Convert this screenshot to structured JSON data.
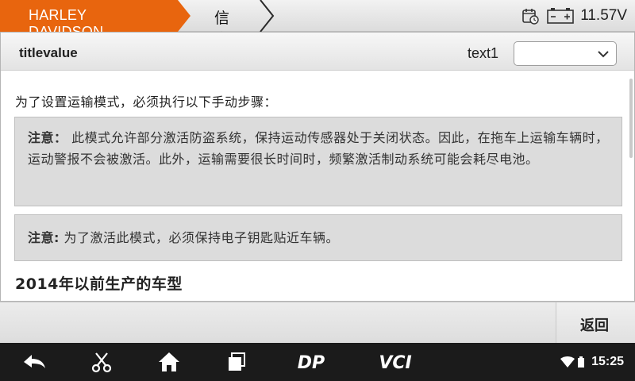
{
  "topbar": {
    "brand": "HARLEY DAVIDSON",
    "current": "信息",
    "voltage": "11.57V",
    "icons": [
      "calendar-clock-icon",
      "battery-icon"
    ],
    "accent_color": "#e8650e"
  },
  "panel": {
    "title": "titlevalue",
    "select_label": "text1",
    "select_value": ""
  },
  "content": {
    "intro": "为了设置运输模式，必须执行以下手动步骤：",
    "note1": {
      "label": "注意：",
      "text": " 此模式允许部分激活防盗系统，保持运动传感器处于关闭状态。因此，在拖车上运输车辆时，运动警报不会被激活。此外，运输需要很长时间时，频繁激活制动系统可能会耗尽电池。"
    },
    "note2": {
      "label": "注意:",
      "text": " 为了激活此模式，必须保持电子钥匙贴近车辆。"
    },
    "section_heading": "2014年以前生产的车型"
  },
  "actions": {
    "back_label": "返回"
  },
  "navbar": {
    "icons": [
      "back-icon",
      "scissors-icon",
      "home-icon",
      "recent-apps-icon",
      "dp-logo-icon",
      "vci-icon",
      "wifi-icon",
      "sim-icon"
    ],
    "dp_text": "DP",
    "vci_text": "VCI",
    "time": "15:25"
  }
}
